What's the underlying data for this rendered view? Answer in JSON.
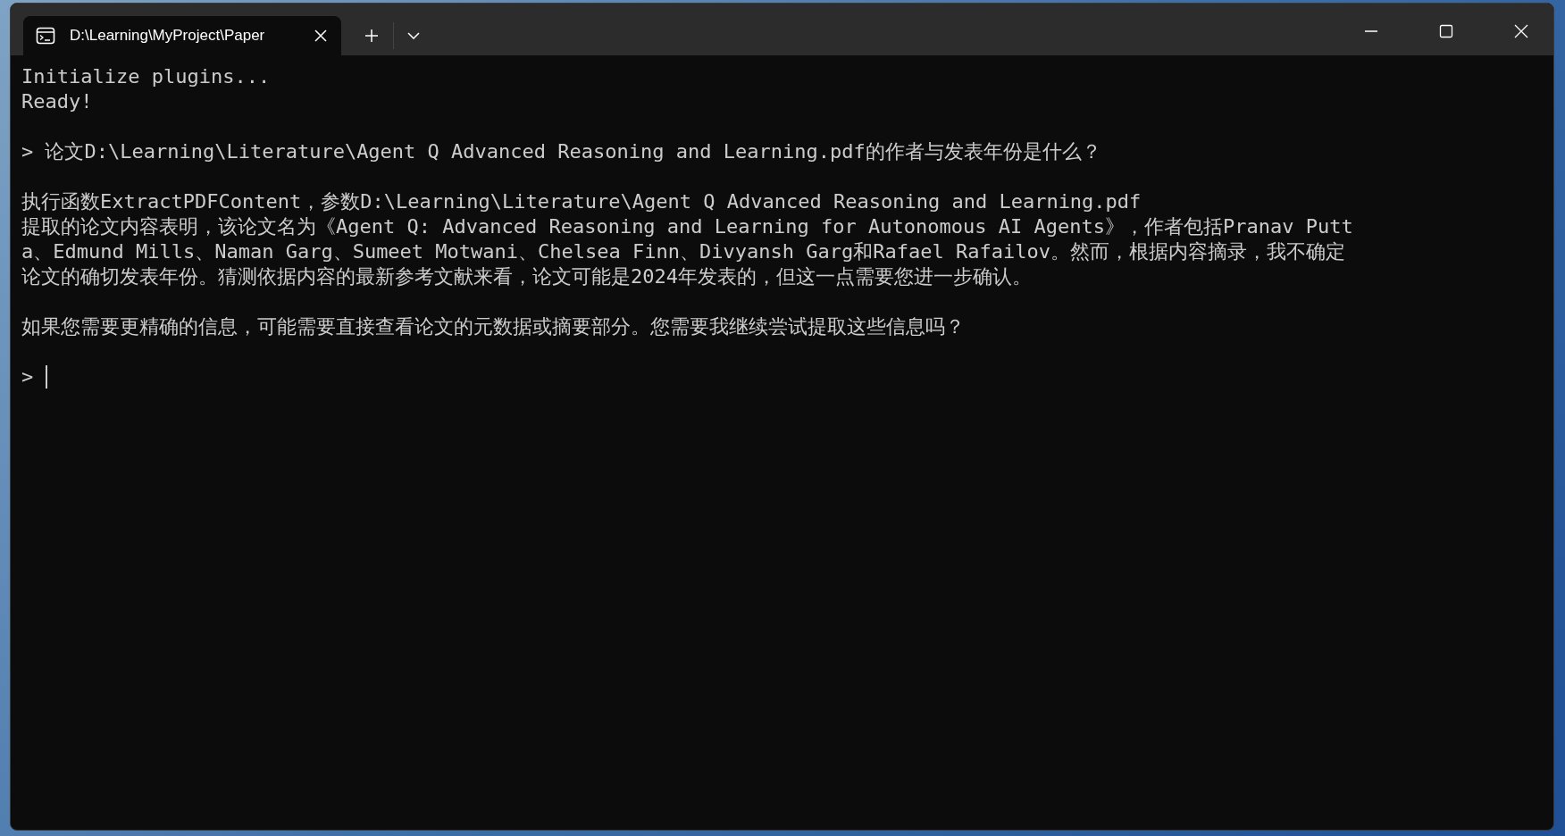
{
  "window": {
    "tab_title": "D:\\Learning\\MyProject\\Paper"
  },
  "terminal": {
    "blocks": [
      {
        "lines": [
          "Initialize plugins...",
          "Ready!"
        ]
      },
      {
        "lines": [
          "> 论文D:\\Learning\\Literature\\Agent Q Advanced Reasoning and Learning.pdf的作者与发表年份是什么？"
        ]
      },
      {
        "lines": [
          "执行函数ExtractPDFContent，参数D:\\Learning\\Literature\\Agent Q Advanced Reasoning and Learning.pdf",
          "提取的论文内容表明，该论文名为《Agent Q: Advanced Reasoning and Learning for Autonomous AI Agents》，作者包括Pranav Putt",
          "a、Edmund Mills、Naman Garg、Sumeet Motwani、Chelsea Finn、Divyansh Garg和Rafael Rafailov。然而，根据内容摘录，我不确定",
          "论文的确切发表年份。猜测依据内容的最新参考文献来看，论文可能是2024年发表的，但这一点需要您进一步确认。"
        ]
      },
      {
        "lines": [
          "如果您需要更精确的信息，可能需要直接查看论文的元数据或摘要部分。您需要我继续尝试提取这些信息吗？"
        ]
      }
    ],
    "prompt": ">"
  }
}
